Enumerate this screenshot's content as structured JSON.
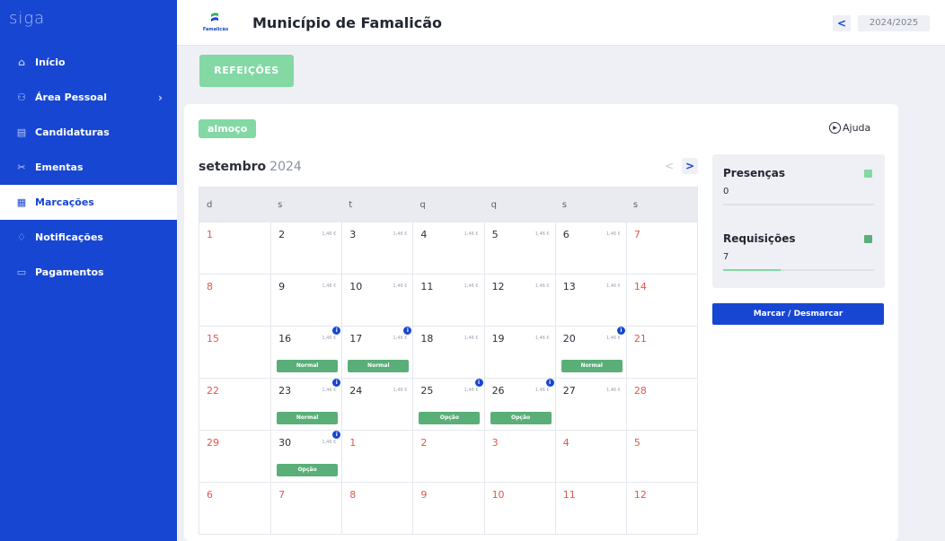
{
  "app": {
    "brand": "siga"
  },
  "sidebar": {
    "items": [
      {
        "label": "Início",
        "icon": "home-icon"
      },
      {
        "label": "Área Pessoal",
        "icon": "user-icon"
      },
      {
        "label": "Candidaturas",
        "icon": "document-icon"
      },
      {
        "label": "Ementas",
        "icon": "utensils-icon"
      },
      {
        "label": "Marcações",
        "icon": "calendar-icon"
      },
      {
        "label": "Notificações",
        "icon": "bell-icon"
      },
      {
        "label": "Pagamentos",
        "icon": "wallet-icon"
      }
    ],
    "active": "Marcações"
  },
  "header": {
    "logo_text": "Famalicão",
    "title": "Município de Famalicão",
    "back_label": "<",
    "school_year": "2024/2025"
  },
  "meal_button": {
    "label": "REFEIÇÕES"
  },
  "calendar_card": {
    "meal_badge": "almoço",
    "help_label": "Ajuda",
    "month": "setembro",
    "year": "2024",
    "prev_label": "<",
    "next_label": ">",
    "weekdays": [
      "d",
      "s",
      "t",
      "q",
      "q",
      "s",
      "s"
    ],
    "weeks": [
      [
        {
          "n": "1",
          "w": true
        },
        {
          "n": "2",
          "p": "1,46 €"
        },
        {
          "n": "3",
          "p": "1,46 €"
        },
        {
          "n": "4",
          "p": "1,46 €"
        },
        {
          "n": "5",
          "p": "1,46 €"
        },
        {
          "n": "6",
          "p": "1,46 €"
        },
        {
          "n": "7",
          "w": true
        }
      ],
      [
        {
          "n": "8",
          "w": true
        },
        {
          "n": "9",
          "p": "1,46 €"
        },
        {
          "n": "10",
          "p": "1,46 €"
        },
        {
          "n": "11",
          "p": "1,46 €"
        },
        {
          "n": "12",
          "p": "1,46 €"
        },
        {
          "n": "13",
          "p": "1,46 €"
        },
        {
          "n": "14",
          "w": true
        }
      ],
      [
        {
          "n": "15",
          "w": true
        },
        {
          "n": "16",
          "p": "1,46 €",
          "dot": true,
          "tag": "Normal"
        },
        {
          "n": "17",
          "p": "1,46 €",
          "dot": true,
          "tag": "Normal"
        },
        {
          "n": "18",
          "p": "1,46 €"
        },
        {
          "n": "19",
          "p": "1,46 €"
        },
        {
          "n": "20",
          "p": "1,46 €",
          "dot": true,
          "tag": "Normal"
        },
        {
          "n": "21",
          "w": true
        }
      ],
      [
        {
          "n": "22",
          "w": true
        },
        {
          "n": "23",
          "p": "1,46 €",
          "dot": true,
          "tag": "Normal"
        },
        {
          "n": "24",
          "p": "1,46 €"
        },
        {
          "n": "25",
          "p": "1,46 €",
          "dot": true,
          "tag": "Opção"
        },
        {
          "n": "26",
          "p": "1,46 €",
          "dot": true,
          "tag": "Opção"
        },
        {
          "n": "27",
          "p": "1,46 €"
        },
        {
          "n": "28",
          "w": true
        }
      ],
      [
        {
          "n": "29",
          "w": true
        },
        {
          "n": "30",
          "p": "1,46 €",
          "dot": true,
          "tag": "Opção"
        },
        {
          "n": "1",
          "o": true
        },
        {
          "n": "2",
          "o": true
        },
        {
          "n": "3",
          "o": true
        },
        {
          "n": "4",
          "o": true
        },
        {
          "n": "5",
          "o": true
        }
      ],
      [
        {
          "n": "6",
          "o": true
        },
        {
          "n": "7",
          "o": true
        },
        {
          "n": "8",
          "o": true
        },
        {
          "n": "9",
          "o": true
        },
        {
          "n": "10",
          "o": true
        },
        {
          "n": "11",
          "o": true
        },
        {
          "n": "12",
          "o": true
        }
      ]
    ]
  },
  "summary": {
    "presencas": {
      "label": "Presenças",
      "value": "0",
      "color": "#83d8a4"
    },
    "requisicoes": {
      "label": "Requisições",
      "value": "7",
      "color": "#5aae78",
      "progress": 0.38
    },
    "action_label": "Marcar / Desmarcar"
  },
  "colors": {
    "primary": "#1746d2",
    "accent_green": "#83d8a4",
    "tag_green": "#5aae78",
    "weekend_red": "#e2574c"
  }
}
